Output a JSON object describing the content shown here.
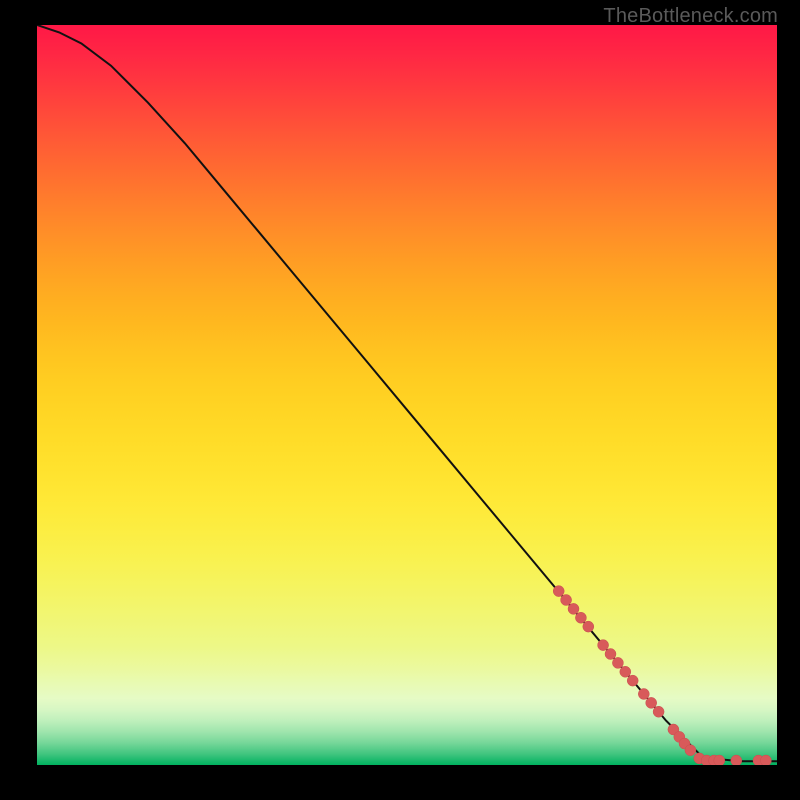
{
  "watermark": "TheBottleneck.com",
  "colors": {
    "curve_line": "#111111",
    "marker_fill": "#d85a5a",
    "marker_stroke": "#c94f4f"
  },
  "chart_data": {
    "type": "line",
    "title": "",
    "xlabel": "",
    "ylabel": "",
    "xlim": [
      0,
      100
    ],
    "ylim": [
      0,
      100
    ],
    "series": [
      {
        "name": "bottleneck-curve",
        "x": [
          0,
          3,
          6,
          10,
          15,
          20,
          25,
          30,
          35,
          40,
          45,
          50,
          55,
          60,
          65,
          70,
          75,
          80,
          85,
          90,
          95,
          100
        ],
        "y": [
          100,
          99,
          97.5,
          94.5,
          89.5,
          84,
          78,
          72,
          66,
          60,
          54,
          48,
          42,
          36,
          30,
          24,
          18,
          12,
          6,
          1,
          0.5,
          0.5
        ]
      }
    ],
    "markers": [
      {
        "x": 70.5,
        "y": 23.5
      },
      {
        "x": 71.5,
        "y": 22.3
      },
      {
        "x": 72.5,
        "y": 21.1
      },
      {
        "x": 73.5,
        "y": 19.9
      },
      {
        "x": 74.5,
        "y": 18.7
      },
      {
        "x": 76.5,
        "y": 16.2
      },
      {
        "x": 77.5,
        "y": 15.0
      },
      {
        "x": 78.5,
        "y": 13.8
      },
      {
        "x": 79.5,
        "y": 12.6
      },
      {
        "x": 80.5,
        "y": 11.4
      },
      {
        "x": 82.0,
        "y": 9.6
      },
      {
        "x": 83.0,
        "y": 8.4
      },
      {
        "x": 84.0,
        "y": 7.2
      },
      {
        "x": 86.0,
        "y": 4.8
      },
      {
        "x": 86.8,
        "y": 3.8
      },
      {
        "x": 87.5,
        "y": 2.9
      },
      {
        "x": 88.3,
        "y": 2.0
      },
      {
        "x": 89.5,
        "y": 0.9
      },
      {
        "x": 90.5,
        "y": 0.6
      },
      {
        "x": 91.5,
        "y": 0.6
      },
      {
        "x": 92.2,
        "y": 0.6
      },
      {
        "x": 94.5,
        "y": 0.6
      },
      {
        "x": 97.5,
        "y": 0.6
      },
      {
        "x": 98.5,
        "y": 0.6
      }
    ],
    "marker_radius_px": 5.5
  }
}
